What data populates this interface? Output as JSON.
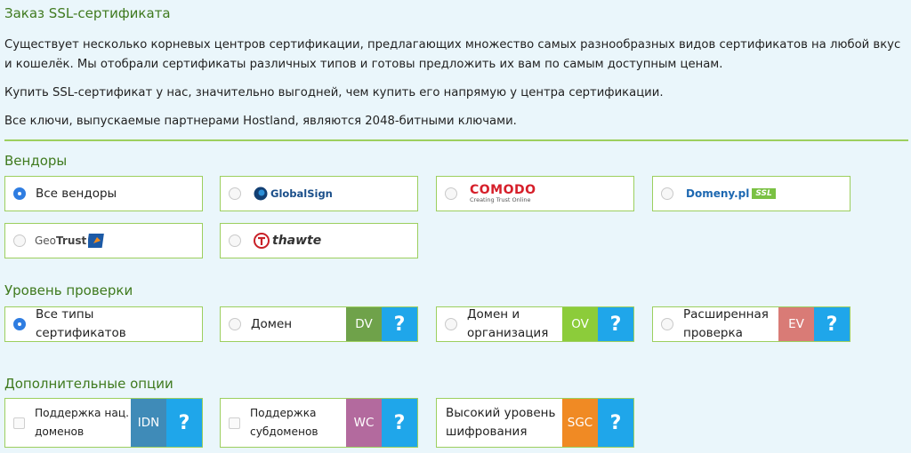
{
  "page": {
    "title": "Заказ SSL-сертификата",
    "para1": "Существует несколько корневых центров сертификации, предлагающих множество самых разнообразных видов сертификатов на любой вкус и кошелёк. Мы отобрали сертификаты различных типов и готовы предложить их вам по самым доступным ценам.",
    "para2": "Купить SSL-сертификат у нас, значительно выгодней, чем купить его напрямую у центра сертификации.",
    "para3": "Все ключи, выпускаемые партнерами Hostland, являются 2048-битными ключами."
  },
  "vendors": {
    "heading": "Вендоры",
    "all_label": "Все вендоры",
    "globalsign": "GlobalSign",
    "comodo_main": "COMODO",
    "comodo_sub": "Creating Trust Online",
    "domeny_main": "Domeny.pl",
    "domeny_tag": "SSL",
    "geotrust_a": "Geo",
    "geotrust_b": "Trust",
    "thawte": "thawte"
  },
  "validation": {
    "heading": "Уровень проверки",
    "all_line1": "Все типы",
    "all_line2": "сертификатов",
    "domain_label": "Домен",
    "domain_badge": "DV",
    "org_line1": "Домен и",
    "org_line2": "организация",
    "org_badge": "OV",
    "ext_line1": "Расширенная",
    "ext_line2": "проверка",
    "ext_badge": "EV",
    "help": "?"
  },
  "options": {
    "heading": "Дополнительные опции",
    "idn_line1": "Поддержка нац.",
    "idn_line2": "доменов",
    "idn_badge": "IDN",
    "wc_line1": "Поддержка",
    "wc_line2": "субдоменов",
    "wc_badge": "WC",
    "sgc_line1": "Высокий уровень",
    "sgc_line2": "шифрования",
    "sgc_badge": "SGC",
    "help": "?"
  },
  "colors": {
    "dv": "#6fa24a",
    "ov": "#8ccc3a",
    "ev": "#d97b76",
    "idn": "#3f8bb8",
    "wc": "#b36a9e",
    "sgc": "#f08a24",
    "help": "#1fa6ea"
  }
}
